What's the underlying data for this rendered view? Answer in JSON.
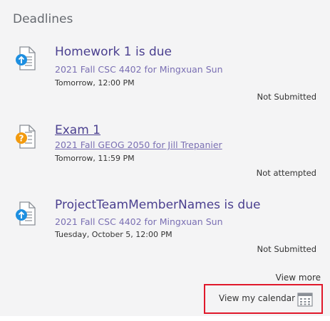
{
  "widget": {
    "title": "Deadlines"
  },
  "deadlines": [
    {
      "title": "Homework 1 is due",
      "course": "2021 Fall CSC 4402 for Mingxuan Sun",
      "time": "Tomorrow, 12:00 PM",
      "status": "Not Submitted",
      "icon": "assignment-upload-icon",
      "icon_color": "#1e8fe0"
    },
    {
      "title": "Exam 1",
      "course": "2021 Fall GEOG 2050 for Jill Trepanier",
      "time": "Tomorrow, 11:59 PM",
      "status": "Not attempted",
      "icon": "quiz-question-icon",
      "icon_color": "#f29a0e"
    },
    {
      "title": "ProjectTeamMemberNames is due",
      "course": "2021 Fall CSC 4402 for Mingxuan Sun",
      "time": "Tuesday, October 5, 12:00 PM",
      "status": "Not Submitted",
      "icon": "assignment-upload-icon",
      "icon_color": "#1e8fe0"
    }
  ],
  "footer": {
    "view_more": "View more",
    "view_calendar": "View my calendar",
    "calendar_icon": "calendar-icon",
    "highlight_color": "#e0182b"
  },
  "colors": {
    "panel_bg": "#f4f4f5",
    "link": "#4a3f8f",
    "course_link": "#7a6fb3"
  }
}
